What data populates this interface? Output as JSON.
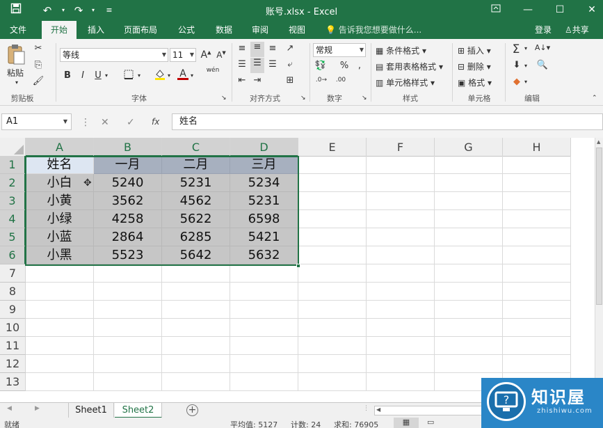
{
  "window": {
    "title": "账号.xlsx - Excel",
    "accent": "#217346"
  },
  "tabs": [
    {
      "label": "文件"
    },
    {
      "label": "开始"
    },
    {
      "label": "插入"
    },
    {
      "label": "页面布局"
    },
    {
      "label": "公式"
    },
    {
      "label": "数据"
    },
    {
      "label": "审阅"
    },
    {
      "label": "视图"
    }
  ],
  "active_tab": "开始",
  "tell_me": "告诉我您想要做什么...",
  "account": {
    "login": "登录",
    "share": "共享"
  },
  "ribbon": {
    "clipboard": {
      "paste": "粘贴",
      "label": "剪贴板"
    },
    "font": {
      "name": "等线",
      "size": "11",
      "label": "字体",
      "wen": "wén"
    },
    "alignment": {
      "label": "对齐方式"
    },
    "number": {
      "format": "常规",
      "label": "数字"
    },
    "styles": {
      "conditional": "条件格式",
      "table": "套用表格格式",
      "cell": "单元格样式",
      "label": "样式"
    },
    "cells": {
      "insert": "插入",
      "delete": "删除",
      "format": "格式",
      "label": "单元格"
    },
    "editing": {
      "label": "编辑"
    }
  },
  "formula_bar": {
    "name_box": "A1",
    "fx": "fx",
    "value": "姓名"
  },
  "columns": [
    "A",
    "B",
    "C",
    "D",
    "E",
    "F",
    "G",
    "H"
  ],
  "rows": [
    "1",
    "2",
    "3",
    "4",
    "5",
    "6",
    "7",
    "8",
    "9",
    "10",
    "11",
    "12",
    "13"
  ],
  "cells": [
    [
      "姓名",
      "一月",
      "二月",
      "三月"
    ],
    [
      "小白",
      "5240",
      "5231",
      "5234"
    ],
    [
      "小黄",
      "3562",
      "4562",
      "5231"
    ],
    [
      "小绿",
      "4258",
      "5622",
      "6598"
    ],
    [
      "小蓝",
      "2864",
      "6285",
      "5421"
    ],
    [
      "小黑",
      "5523",
      "5642",
      "5632"
    ]
  ],
  "sheets": [
    "Sheet1",
    "Sheet2"
  ],
  "active_sheet": "Sheet2",
  "status": {
    "ready": "就绪",
    "average": "平均值: 5127",
    "count": "计数: 24",
    "sum": "求和: 76905"
  },
  "watermark": {
    "brand": "知识屋",
    "domain": "zhishiwu.com"
  }
}
